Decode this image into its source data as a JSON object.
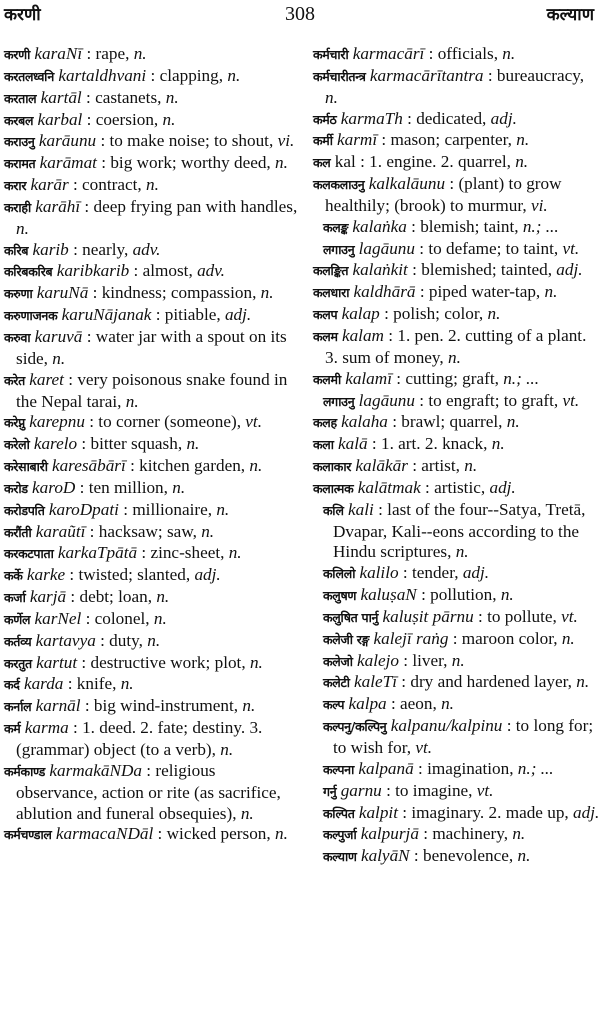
{
  "page": {
    "running_head_left": "करणी",
    "page_number": "308",
    "running_head_right": "कल्याण"
  },
  "left_column": [
    {
      "hw": "करणी",
      "tr": "karaNī",
      "gl": "rape,",
      "pos": "n."
    },
    {
      "hw": "करतलध्वनि",
      "tr": "kartaldhvani",
      "gl": "clapping,",
      "pos": "n."
    },
    {
      "hw": "करताल",
      "tr": "kartāl",
      "gl": "castanets,",
      "pos": "n."
    },
    {
      "hw": "करबल",
      "tr": "karbal",
      "gl": "coersion,",
      "pos": "n."
    },
    {
      "hw": "कराउनु",
      "tr": "karāunu",
      "gl": "to make noise; to shout,",
      "pos": "vi."
    },
    {
      "hw": "करामत",
      "tr": "karāmat",
      "gl": "big work; worthy deed,",
      "pos": "n."
    },
    {
      "hw": "करार",
      "tr": "karār",
      "gl": "contract,",
      "pos": "n."
    },
    {
      "hw": "कराही",
      "tr": "karāhī",
      "gl": "deep frying pan with handles,",
      "pos": "n."
    },
    {
      "hw": "करिब",
      "tr": "karib",
      "gl": "nearly,",
      "pos": "adv."
    },
    {
      "hw": "करिबकरिब",
      "tr": "karibkarib",
      "gl": "almost,",
      "pos": "adv."
    },
    {
      "hw": "करुणा",
      "tr": "karuNā",
      "gl": "kindness; compassion,",
      "pos": "n."
    },
    {
      "hw": "करुणाजनक",
      "tr": "karuNājanak",
      "gl": "pitiable,",
      "pos": "adj."
    },
    {
      "hw": "करुवा",
      "tr": "karuvā",
      "gl": "water jar with a spout on its side,",
      "pos": "n."
    },
    {
      "hw": "करेत",
      "tr": "karet",
      "gl": "very poisonous snake found in the Nepal tarai,",
      "pos": "n."
    },
    {
      "hw": "करेप्नु",
      "tr": "karepnu",
      "gl": "to corner (someone),",
      "pos": "vt."
    },
    {
      "hw": "करेलो",
      "tr": "karelo",
      "gl": "bitter squash,",
      "pos": "n."
    },
    {
      "hw": "करेसाबारी",
      "tr": "karesābārī",
      "gl": "kitchen garden,",
      "pos": "n."
    },
    {
      "hw": "करोड",
      "tr": "karoD",
      "gl": "ten million,",
      "pos": "n."
    },
    {
      "hw": "करोडपति",
      "tr": "karoDpati",
      "gl": "millionaire,",
      "pos": "n."
    },
    {
      "hw": "करौंती",
      "tr": "karaũtī",
      "gl": "hacksaw; saw,",
      "pos": "n."
    },
    {
      "hw": "करकटपाता",
      "tr": "karkaTpātā",
      "gl": "zinc-sheet,",
      "pos": "n."
    },
    {
      "hw": "कर्के",
      "tr": "karke",
      "gl": "twisted; slanted,",
      "pos": "adj."
    },
    {
      "hw": "कर्जा",
      "tr": "karjā",
      "gl": "debt; loan,",
      "pos": "n."
    },
    {
      "hw": "कर्णेल",
      "tr": "karNel",
      "gl": "colonel,",
      "pos": "n."
    },
    {
      "hw": "कर्तव्य",
      "tr": "kartavya",
      "gl": "duty,",
      "pos": "n."
    },
    {
      "hw": "करतुत",
      "tr": "kartut",
      "gl": "destructive work; plot,",
      "pos": "n."
    },
    {
      "hw": "कर्द",
      "tr": "karda",
      "gl": "knife,",
      "pos": "n."
    },
    {
      "hw": "कर्नाल",
      "tr": "karnāl",
      "gl": "big wind-instrument,",
      "pos": "n."
    },
    {
      "hw": "कर्म",
      "tr": "karma",
      "gl": "1. deed. 2. fate; destiny. 3. (grammar) object (to a verb),",
      "pos": "n."
    },
    {
      "hw": "कर्मकाण्ड",
      "tr": "karmakāNDa",
      "gl": "religious observance, action or rite (as sacrifice, ablution and funeral obsequies),",
      "pos": "n."
    },
    {
      "hw": "कर्मचण्डाल",
      "tr": "karmacaNDāl",
      "gl": "wicked person,",
      "pos": "n."
    }
  ],
  "right_column": [
    {
      "hw": "कर्मचारी",
      "tr": "karmacārī",
      "gl": "officials,",
      "pos": "n."
    },
    {
      "hw": "कर्मचारीतन्त्र",
      "tr": "karmacārītantra",
      "gl": "bureaucracy,",
      "pos": "n."
    },
    {
      "hw": "कर्मठ",
      "tr": "karmaTh",
      "gl": "dedicated,",
      "pos": "adj."
    },
    {
      "hw": "कर्मी",
      "tr": "karmī",
      "gl": "mason; carpenter,",
      "pos": "n."
    },
    {
      "hw": "कल",
      "tr": "kal",
      "roman": true,
      "gl": "1. engine. 2. quarrel,",
      "pos": "n."
    },
    {
      "hw": "कलकलाउनु",
      "tr": "kalkalāunu",
      "gl": "(plant) to grow healthily; (brook) to murmur,",
      "pos": "vi."
    },
    {
      "hw": "कलङ्क",
      "tr": "kalaṅka",
      "gl": "blemish; taint,",
      "pos": "n.; ...",
      "inset": true
    },
    {
      "hw": "लगाउनु",
      "tr": "lagāunu",
      "gl": "to defame; to taint,",
      "pos": "vt.",
      "inset": true
    },
    {
      "hw": "कलङ्कित",
      "tr": "kalaṅkit",
      "gl": "blemished; tainted,",
      "pos": "adj."
    },
    {
      "hw": "कलधारा",
      "tr": "kaldhārā",
      "gl": "piped water-tap,",
      "pos": "n."
    },
    {
      "hw": "कलप",
      "tr": "kalap",
      "gl": "polish; color,",
      "pos": "n."
    },
    {
      "hw": "कलम",
      "tr": "kalam",
      "gl": "1. pen. 2. cutting of a plant. 3. sum of money,",
      "pos": "n."
    },
    {
      "hw": "कलमी",
      "tr": "kalamī",
      "gl": "cutting; graft,",
      "pos": "n.; ..."
    },
    {
      "hw": "लगाउनु",
      "tr": "lagāunu",
      "gl": "to engraft; to graft,",
      "pos": "vt.",
      "inset": true
    },
    {
      "hw": "कलह",
      "tr": "kalaha",
      "gl": "brawl; quarrel,",
      "pos": "n."
    },
    {
      "hw": "कला",
      "tr": "kalā",
      "gl": "1. art. 2. knack,",
      "pos": "n."
    },
    {
      "hw": "कलाकार",
      "tr": "kalākār",
      "gl": "artist,",
      "pos": "n."
    },
    {
      "hw": "कलात्मक",
      "tr": "kalātmak",
      "gl": "artistic,",
      "pos": "adj."
    },
    {
      "hw": "कलि",
      "tr": "kali",
      "gl": "last of the four--Satya, Tretā, Dvapar, Kali--eons according to the Hindu scriptures,",
      "pos": "n.",
      "inset": true
    },
    {
      "hw": "कलिलो",
      "tr": "kalilo",
      "gl": "tender,",
      "pos": "adj.",
      "inset": true
    },
    {
      "hw": "कलुषण",
      "tr": "kaluṣaN",
      "gl": "pollution,",
      "pos": "n.",
      "inset": true
    },
    {
      "hw": "कलुषित पार्नु",
      "tr": "kaluṣit pārnu",
      "gl": "to pollute,",
      "pos": "vt.",
      "inset": true
    },
    {
      "hw": "कलेजी रङ्ग",
      "tr": "kalejī raṅg",
      "gl": "maroon color,",
      "pos": "n.",
      "inset": true
    },
    {
      "hw": "कलेजो",
      "tr": "kalejo",
      "gl": "liver,",
      "pos": "n.",
      "inset": true
    },
    {
      "hw": "कलेटी",
      "tr": "kaleTī",
      "gl": "dry and hardened layer,",
      "pos": "n.",
      "inset": true
    },
    {
      "hw": "कल्प",
      "tr": "kalpa",
      "gl": "aeon,",
      "pos": "n.",
      "inset": true
    },
    {
      "hw": "कल्पनु/कल्पिनु",
      "tr": "kalpanu/kalpinu",
      "gl": "to long for; to wish for,",
      "pos": "vt.",
      "inset": true
    },
    {
      "hw": "कल्पना",
      "tr": "kalpanā",
      "gl": "imagination,",
      "pos": "n.; ...",
      "inset": true
    },
    {
      "hw": "गर्नु",
      "tr": "garnu",
      "gl": "to imagine,",
      "pos": "vt.",
      "inset": true,
      "sub": true
    },
    {
      "hw": "कल्पित",
      "tr": "kalpit",
      "gl": "imaginary. 2. made up,",
      "pos": "adj.",
      "inset": true
    },
    {
      "hw": "कल्पुर्जा",
      "tr": "kalpurjā",
      "gl": "machinery,",
      "pos": "n.",
      "inset": true
    },
    {
      "hw": "कल्याण",
      "tr": "kalyāN",
      "gl": "benevolence,",
      "pos": "n.",
      "inset": true
    }
  ]
}
